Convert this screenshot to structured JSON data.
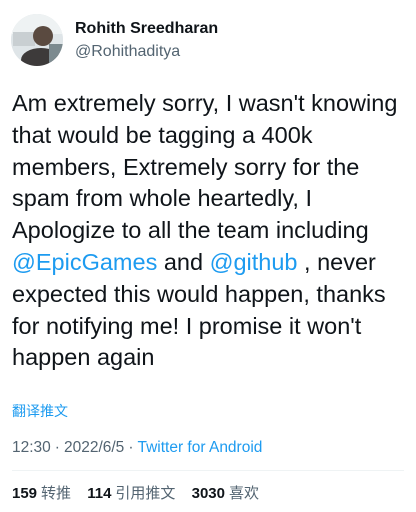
{
  "author": {
    "display_name": "Rohith Sreedharan",
    "handle": "@Rohithaditya"
  },
  "tweet": {
    "text_part1": "Am extremely sorry, I wasn't knowing that would be tagging a 400k members, Extremely sorry for the spam from whole heartedly, I Apologize to all the team including ",
    "mention1": "@EpicGames",
    "text_part2": " and ",
    "mention2": "@github",
    "text_part3": " , never expected this would happen, thanks for notifying me! I promise it won't happen again"
  },
  "translate_label": "翻译推文",
  "meta": {
    "time": "12:30",
    "separator": "·",
    "date": "2022/6/5",
    "source": "Twitter for Android"
  },
  "stats": {
    "retweets_count": "159",
    "retweets_label": "转推",
    "quotes_count": "114",
    "quotes_label": "引用推文",
    "likes_count": "3030",
    "likes_label": "喜欢"
  }
}
